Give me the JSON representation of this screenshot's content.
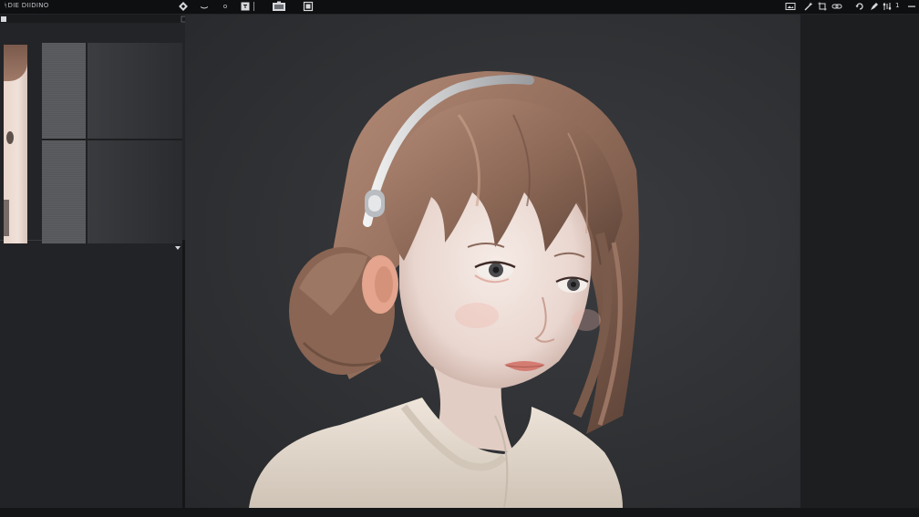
{
  "app": {
    "title": "ᛋDIE DIIDINO"
  },
  "toolbar": {
    "left_tools": [
      "diamond-tool-icon",
      "brush-icon",
      "dot-icon",
      "frame-icon",
      "separator",
      "film-icon",
      "layers-icon"
    ],
    "right_tools": [
      "image-icon",
      "wand-icon",
      "crop-icon",
      "link-icon",
      "undo-icon",
      "pen-icon",
      "levels-icon",
      "more-icon"
    ],
    "right_label": "1"
  },
  "canvas": {
    "image": "portrait-girl-headband",
    "background_color": "#2f3134",
    "hair_color": "#8f6a58",
    "sweater_color": "#e6dacd"
  }
}
